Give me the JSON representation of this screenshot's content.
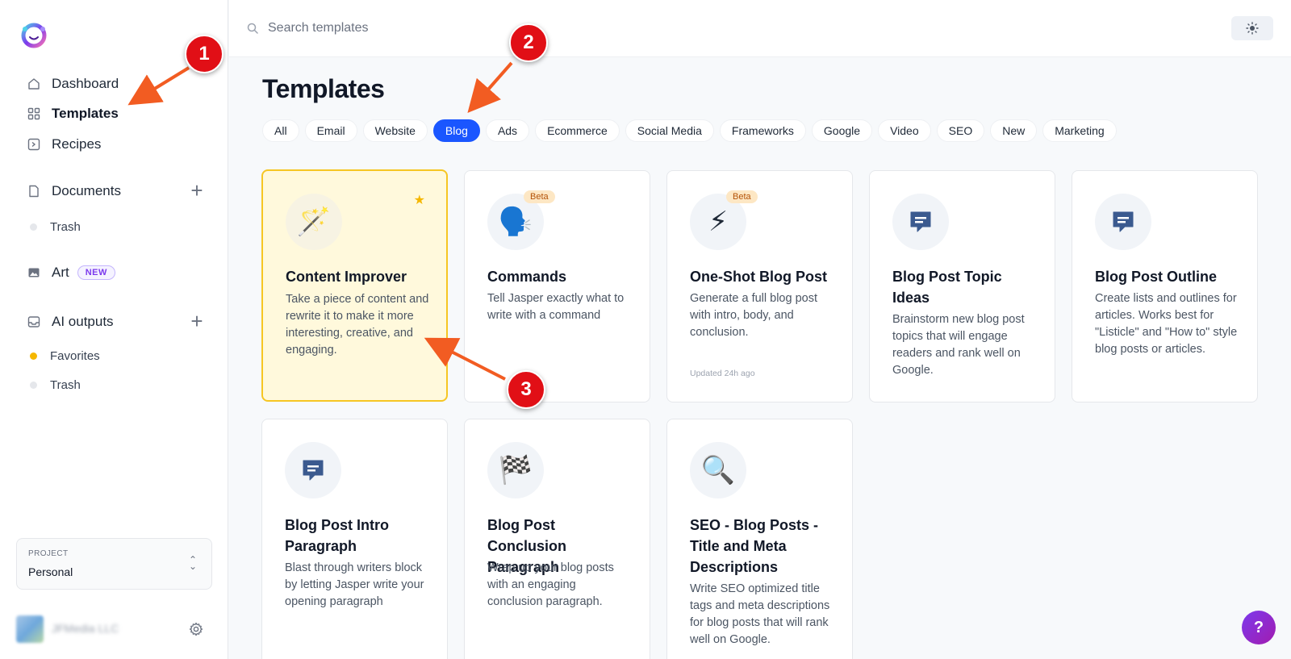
{
  "sidebar": {
    "nav": [
      {
        "label": "Dashboard",
        "icon": "home-icon"
      },
      {
        "label": "Templates",
        "icon": "grid-icon",
        "active": true
      },
      {
        "label": "Recipes",
        "icon": "recipe-icon"
      }
    ],
    "documents": {
      "label": "Documents",
      "trash_label": "Trash"
    },
    "art": {
      "label": "Art",
      "badge": "NEW"
    },
    "ai_outputs": {
      "label": "AI outputs",
      "favorites_label": "Favorites",
      "trash_label": "Trash"
    },
    "project": {
      "label": "PROJECT",
      "value": "Personal"
    },
    "user": {
      "name": "JFMedia LLC"
    }
  },
  "topbar": {
    "search_placeholder": "Search templates"
  },
  "main": {
    "title": "Templates",
    "filters": [
      "All",
      "Email",
      "Website",
      "Blog",
      "Ads",
      "Ecommerce",
      "Social Media",
      "Frameworks",
      "Google",
      "Video",
      "SEO",
      "New",
      "Marketing"
    ],
    "active_filter": "Blog",
    "cards": [
      {
        "title": "Content Improver",
        "desc": "Take a piece of content and rewrite it to make it more interesting, creative, and engaging.",
        "icon": "magic-wand-icon",
        "featured": true
      },
      {
        "title": "Commands",
        "desc": "Tell Jasper exactly what to write with a command",
        "icon": "speaking-head-icon",
        "badge": "Beta"
      },
      {
        "title": "One-Shot Blog Post",
        "desc": "Generate a full blog post with intro, body, and conclusion.",
        "icon": "lightning-icon",
        "badge": "Beta",
        "updated": "Updated 24h ago"
      },
      {
        "title": "Blog Post Topic Ideas",
        "desc": "Brainstorm new blog post topics that will engage readers and rank well on Google.",
        "icon": "message-icon"
      },
      {
        "title": "Blog Post Outline",
        "desc": "Create lists and outlines for articles. Works best for \"Listicle\" and \"How to\" style blog posts or articles.",
        "icon": "message-icon"
      },
      {
        "title": "Blog Post Intro Paragraph",
        "desc": "Blast through writers block by letting Jasper write your opening paragraph",
        "icon": "message-icon"
      },
      {
        "title": "Blog Post Conclusion Paragraph",
        "desc": "Wrap up your blog posts with an engaging conclusion paragraph.",
        "icon": "checkered-flag-icon"
      },
      {
        "title": "SEO - Blog Posts - Title and Meta Descriptions",
        "desc": "Write SEO optimized title tags and meta descriptions for blog posts that will rank well on Google.",
        "icon": "magnifier-icon"
      }
    ]
  },
  "help": {
    "label": "?"
  },
  "annotations": [
    "1",
    "2",
    "3"
  ],
  "colors": {
    "accent": "#1a56ff",
    "featured_border": "#f6c623",
    "annotation": "#e10f16",
    "arrow": "#f25c22"
  }
}
